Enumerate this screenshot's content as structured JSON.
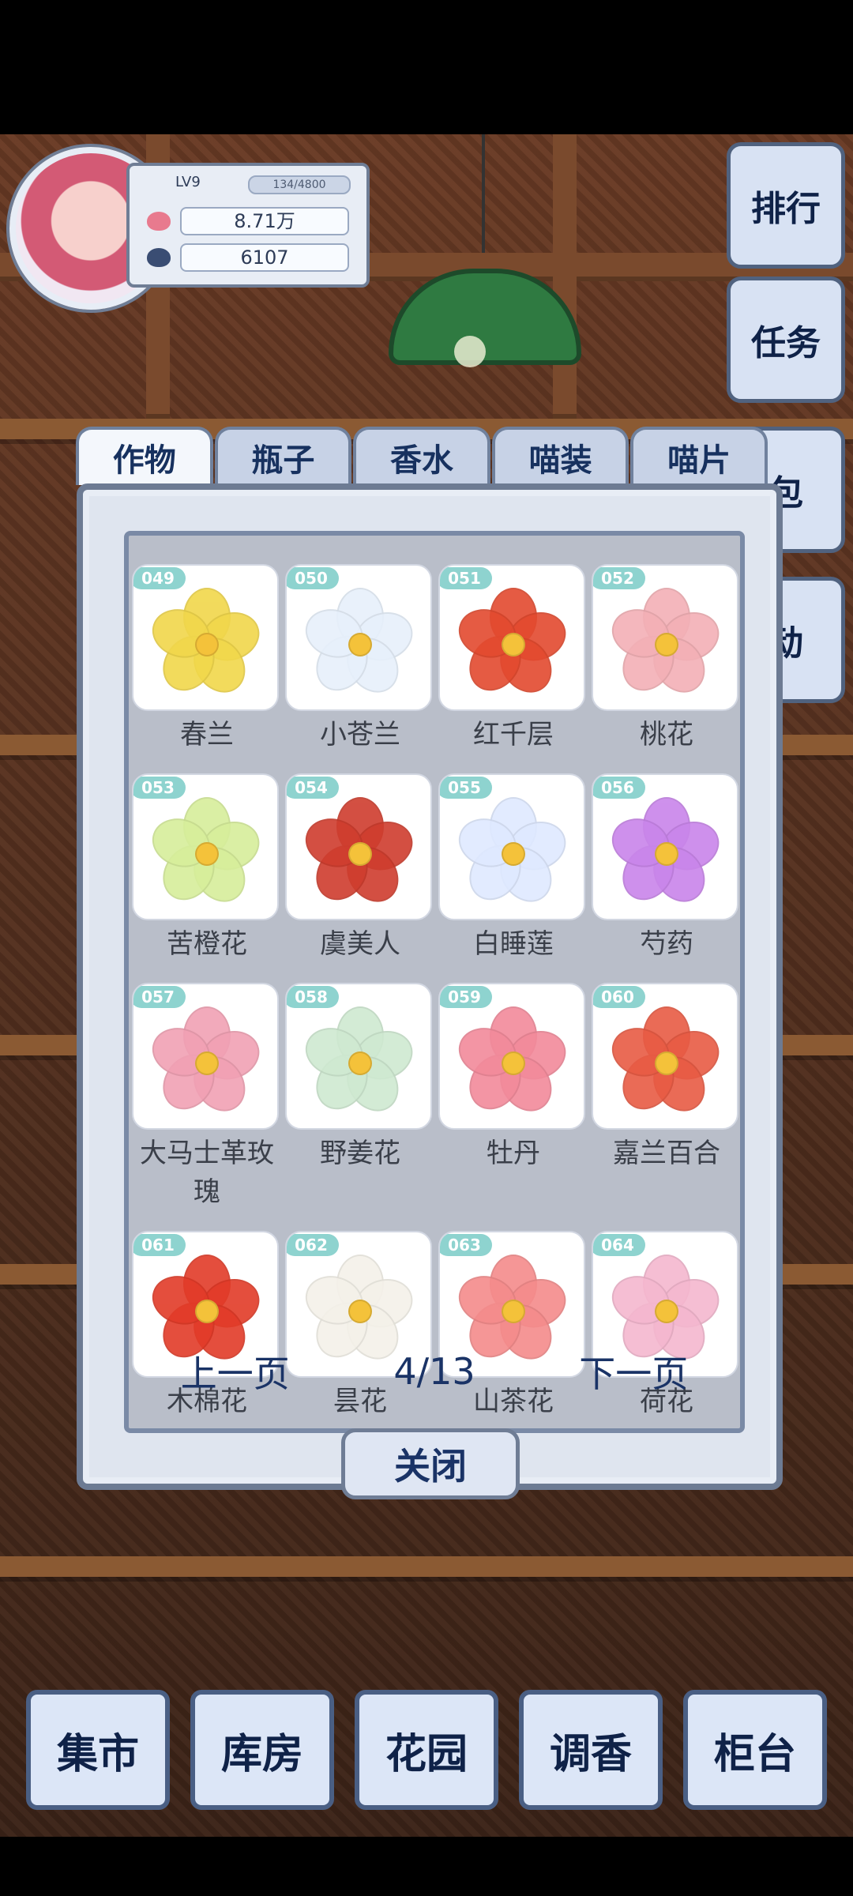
{
  "player": {
    "level": "LV9",
    "exp": "134/4800",
    "coins": "8.71万",
    "currency2": "6107"
  },
  "side_buttons": [
    "排行",
    "任务",
    "包",
    "动"
  ],
  "tabs": [
    "作物",
    "瓶子",
    "香水",
    "喵装",
    "喵片"
  ],
  "items": [
    {
      "id": "049",
      "name": "春兰",
      "color": "#f1d74b"
    },
    {
      "id": "050",
      "name": "小苍兰",
      "color": "#e7f0fb"
    },
    {
      "id": "051",
      "name": "红千层",
      "color": "#e34a2f"
    },
    {
      "id": "052",
      "name": "桃花",
      "color": "#f3b0b6"
    },
    {
      "id": "053",
      "name": "苦橙花",
      "color": "#d7ee9b"
    },
    {
      "id": "054",
      "name": "虞美人",
      "color": "#cf3d2e"
    },
    {
      "id": "055",
      "name": "白睡莲",
      "color": "#dfe9ff"
    },
    {
      "id": "056",
      "name": "芍药",
      "color": "#c985ea"
    },
    {
      "id": "057",
      "name": "大马士革玫瑰",
      "color": "#f1a1b4"
    },
    {
      "id": "058",
      "name": "野姜花",
      "color": "#cfe9d1"
    },
    {
      "id": "059",
      "name": "牡丹",
      "color": "#f28a9b"
    },
    {
      "id": "060",
      "name": "嘉兰百合",
      "color": "#e85b44"
    },
    {
      "id": "061",
      "name": "木棉花",
      "color": "#e23b28"
    },
    {
      "id": "062",
      "name": "昙花",
      "color": "#f4f1e9"
    },
    {
      "id": "063",
      "name": "山茶花",
      "color": "#f48b8b"
    },
    {
      "id": "064",
      "name": "荷花",
      "color": "#f4b7cf"
    }
  ],
  "pager": {
    "prev": "上一页",
    "indicator": "4/13",
    "next": "下一页"
  },
  "close_label": "关闭",
  "bottom_nav": [
    "集市",
    "库房",
    "花园",
    "调香",
    "柜台"
  ]
}
